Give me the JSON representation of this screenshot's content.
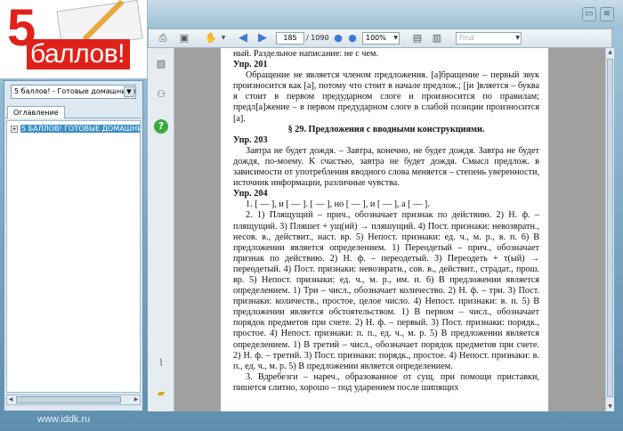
{
  "brand": {
    "digit": "5",
    "word": "баллов!",
    "url": "www.iddk.ru"
  },
  "left_panel": {
    "book_select": "5 баллов! - Готовые домашние за",
    "tab": "Оглавление",
    "tree_item": "5 БАЛЛОВ! ГОТОВЫЕ ДОМАШНИЕ :"
  },
  "toolbar": {
    "page_current": "185",
    "page_total": "/ 1090",
    "zoom": "100%",
    "find_placeholder": "Find"
  },
  "document": {
    "line0": "ный. Раздельное написание: не с чем.",
    "ex201": "Упр. 201",
    "ex201_text": "Обращение не является членом предложения. [а]бращение – первый звук произносится как [а], потому что стоит в начале предлож.; [ји ]вляется – буква я стоит в первом предударном слоге и произносится по правилам; предл[а]жение – в первом предударном слоге в слабой позиции произносится [а].",
    "section": "§ 29. Предложения с вводными конструкциями.",
    "ex203": "Упр. 203",
    "ex203_text": "Завтра не будет дождя. – Завтра, конечно, не будет дождя. Завтра не будет дождя, по-моему. К счастью, завтра не будет дождя. Смысл предлож. в зависимости от употребления вводного слова меняется – степень уверенности, источник информации, различные чувства.",
    "ex204": "Упр. 204",
    "ex204_schema": "1. [ — ], и [ — ]. [ — ], но [ — ], и [ — ], а [ — ].",
    "ex204_text": "2. 1) Плящущий – прич., обозначает признак по действию. 2) Н. ф. – плящущий. 3) Пляшет + ущ(ий) → пляшущий. 4) Пост. признаки: невозвратн., несов. в., действит., наст. вр. 5) Непост. признаки: ед. ч., м. р., в. п. 6) В предложении является определением. 1) Переодетый – прич., обозначает признак по действию. 2) Н. ф. – переодетый. 3) Переодеть + т(ый) → переодетый. 4) Пост. признаки: невозвратн., сов. в., действит., страдат., прош. вр. 5) Непост. признаки: ед. ч., м. р., им. п. 6) В предложении является определением. 1) Три – числ., обозначает количество. 2) Н. ф. – три. 3) Пост. признаки: количеств., простое, целое число. 4) Непост. признаки: в. п. 5) В предложении является обстоятельством. 1) В первом – числ., обозначает порядок предметов при счете. 2) Н. ф. – первый. 3) Пост. признаки: порядк., простое. 4) Непост. признаки: п. п., ед. ч., м. р. 5) В предложении является определением. 1) В третий – числ., обозначает порядок предметов при счете. 2) Н. ф. – третий. 3) Пост. признаки: порядк., простое. 4) Непост. признаки: в. п., ед. ч., м. р. 5) В предложении является определением.",
    "ex204_tail": "3. Вдребезги – нареч., образованное от сущ. при помощи приставки, пишется слитно, хорошо – под ударением после шипящих"
  },
  "icons": {
    "print": "printer-icon",
    "save": "save-icon",
    "back": "arrow-left-icon",
    "forward": "arrow-right-icon"
  }
}
